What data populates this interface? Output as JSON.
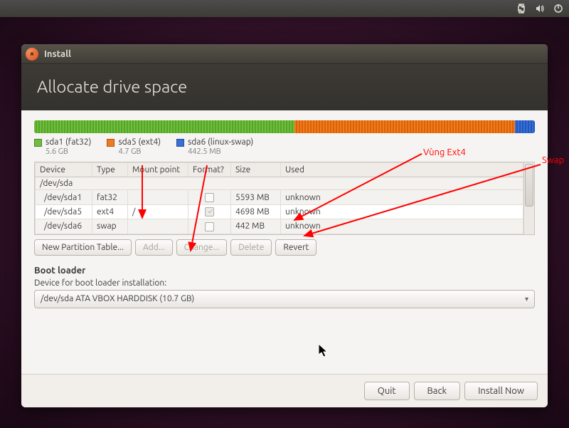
{
  "panel": {
    "icons": [
      "network-icon",
      "sound-icon",
      "power-icon"
    ]
  },
  "window": {
    "title": "Install",
    "heading": "Allocate drive space"
  },
  "disk": {
    "segments": [
      {
        "color": "#6fbe3f",
        "pct": 52
      },
      {
        "color": "#f27a1f",
        "pct": 44
      },
      {
        "color": "#3a6fd6",
        "pct": 4
      }
    ]
  },
  "legend": [
    {
      "color": "#6fbe3f",
      "label": "sda1 (fat32)",
      "sub": "5.6 GB"
    },
    {
      "color": "#f27a1f",
      "label": "sda5 (ext4)",
      "sub": "4.7 GB"
    },
    {
      "color": "#3a6fd6",
      "label": "sda6 (linux-swap)",
      "sub": "442.5 MB"
    }
  ],
  "columns": {
    "device": "Device",
    "type": "Type",
    "mount": "Mount point",
    "format": "Format?",
    "size": "Size",
    "used": "Used"
  },
  "rows": [
    {
      "device": "/dev/sda",
      "type": "",
      "mount": "",
      "format": "",
      "size": "",
      "used": "",
      "header": true
    },
    {
      "device": "/dev/sda1",
      "type": "fat32",
      "mount": "",
      "format": "unchecked",
      "size": "5593 MB",
      "used": "unknown"
    },
    {
      "device": "/dev/sda5",
      "type": "ext4",
      "mount": "/",
      "format": "checked-dim",
      "size": "4698 MB",
      "used": "unknown",
      "selected": true
    },
    {
      "device": "/dev/sda6",
      "type": "swap",
      "mount": "",
      "format": "unchecked",
      "size": "442 MB",
      "used": "unknown"
    }
  ],
  "partButtons": {
    "newTable": "New Partition Table...",
    "add": "Add...",
    "change": "Change...",
    "delete": "Delete",
    "revert": "Revert"
  },
  "boot": {
    "heading": "Boot loader",
    "label": "Device for boot loader installation:",
    "selected": "/dev/sda ATA VBOX HARDDISK (10.7 GB)"
  },
  "footer": {
    "quit": "Quit",
    "back": "Back",
    "install": "Install Now"
  },
  "annotations": {
    "ext4": "Vùng Ext4",
    "swap": "Swap"
  }
}
